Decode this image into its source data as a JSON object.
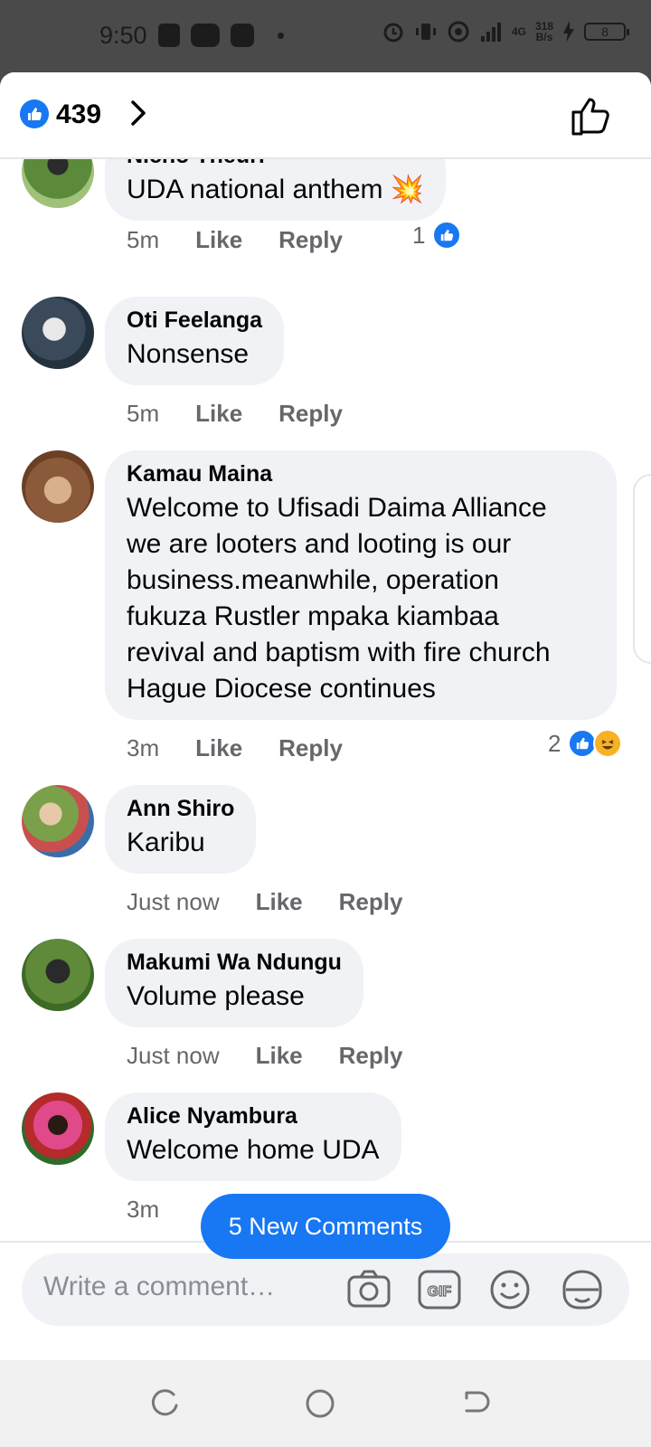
{
  "status_bar": {
    "time": "9:50",
    "network_type": "4G",
    "net_speed": "318",
    "net_unit": "B/s",
    "battery": "8"
  },
  "header": {
    "like_count": "439"
  },
  "comments": [
    {
      "name": "Nicho Theuri",
      "text": "UDA national anthem",
      "emoji": "💥",
      "time": "5m",
      "like": "Like",
      "reply": "Reply",
      "reaction_count": "1"
    },
    {
      "name": "Oti Feelanga",
      "text": "Nonsense",
      "time": "5m",
      "like": "Like",
      "reply": "Reply"
    },
    {
      "name": "Kamau Maina",
      "text_lines": [
        "Welcome to Ufisadi Daima Alliance",
        "we are looters and looting is our",
        "business.meanwhile, operation",
        "fukuza Rustler mpaka kiambaa",
        "revival and baptism with fire church",
        "Hague Diocese continues"
      ],
      "time": "3m",
      "like": "Like",
      "reply": "Reply",
      "reaction_count": "2"
    },
    {
      "name": "Ann Shiro",
      "text": "Karibu",
      "time": "Just now",
      "like": "Like",
      "reply": "Reply"
    },
    {
      "name": "Makumi Wa Ndungu",
      "text": "Volume please",
      "time": "Just now",
      "like": "Like",
      "reply": "Reply"
    },
    {
      "name": "Alice Nyambura",
      "text": "Welcome home UDA",
      "time": "3m"
    }
  ],
  "new_comments_button": "5 New Comments",
  "composer": {
    "placeholder": "Write a comment…"
  },
  "colors": {
    "accent": "#1877f2",
    "bubble": "#f0f2f5",
    "secondary_text": "#65676b"
  }
}
